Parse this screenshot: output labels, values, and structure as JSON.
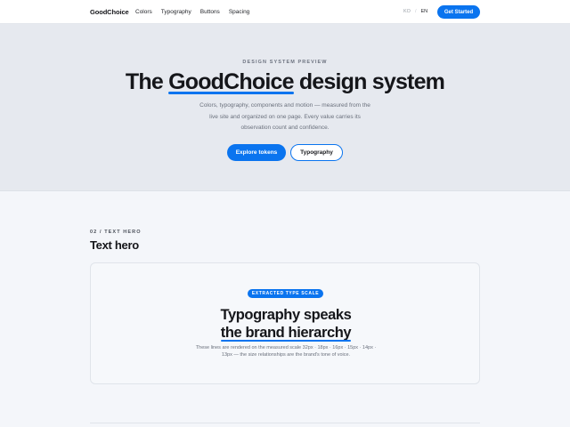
{
  "nav": {
    "brand": "GoodChoice",
    "links": [
      "Colors",
      "Typography",
      "Buttons",
      "Spacing"
    ],
    "lang": {
      "ko": "KO",
      "separator": "/",
      "en": "EN"
    },
    "cta": "Get Started"
  },
  "hero": {
    "eyebrow": "DESIGN SYSTEM PREVIEW",
    "title_pre": "The ",
    "title_highlight": "GoodChoice",
    "title_post": " design system",
    "description": "Colors, typography, components and motion — measured from the live site and organized on one page. Every value carries its observation count and confidence.",
    "primary_button": "Explore tokens",
    "secondary_button": "Typography"
  },
  "section": {
    "eyebrow": "02 / TEXT HERO",
    "title": "Text hero",
    "card": {
      "badge": "EXTRACTED TYPE SCALE",
      "line1": "Typography speaks",
      "line2": "the brand hierarchy",
      "description": "These lines are rendered on the measured scale 32px · 18px · 16px · 15px · 14px · 13px — the size relationships are the brand's tone of voice."
    }
  },
  "colors": {
    "accent": "#0a74ef",
    "hero_bg": "#e6e9ef",
    "page_bg": "#f4f6fa"
  }
}
